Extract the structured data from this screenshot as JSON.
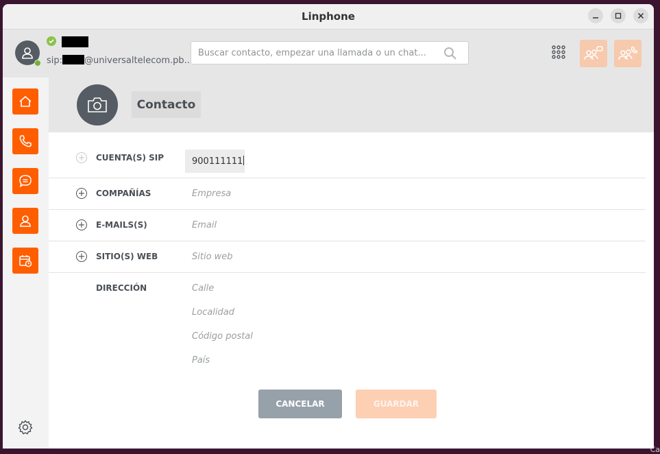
{
  "window": {
    "title": "Linphone"
  },
  "account": {
    "sip_prefix": "sip:",
    "sip_domain": "@universaltelecom.pb..."
  },
  "search": {
    "placeholder": "Buscar contacto, empezar una llamada o un chat..."
  },
  "contact": {
    "name": "Contacto",
    "fields": [
      {
        "label": "CUENTA(S) SIP",
        "value": "900111111"
      },
      {
        "label": "COMPAÑÍAS",
        "placeholder": "Empresa"
      },
      {
        "label": "E-MAILS(S)",
        "placeholder": "Email"
      },
      {
        "label": "SITIO(S) WEB",
        "placeholder": "Sitio web"
      }
    ],
    "address": {
      "label": "DIRECCIÓN",
      "street": "Calle",
      "city": "Localidad",
      "postal": "Código postal",
      "country": "País"
    }
  },
  "actions": {
    "cancel": "CANCELAR",
    "save": "GUARDAR"
  },
  "desktop": {
    "corner_text": "Ca"
  },
  "colors": {
    "accent": "#ff5e00",
    "accent_light": "#f7c9ad",
    "header_bg": "#e6e6e6",
    "cancel_bg": "#96a1aa",
    "presence": "#73b42c"
  },
  "icons": [
    "avatar-icon",
    "check-icon",
    "search-icon",
    "dialpad-icon",
    "new-chat-group-icon",
    "conference-icon",
    "home-icon",
    "phone-icon",
    "chat-icon",
    "contacts-icon",
    "calendar-icon",
    "settings-icon",
    "camera-icon",
    "minimize-icon",
    "maximize-icon",
    "close-icon",
    "plus-icon"
  ]
}
